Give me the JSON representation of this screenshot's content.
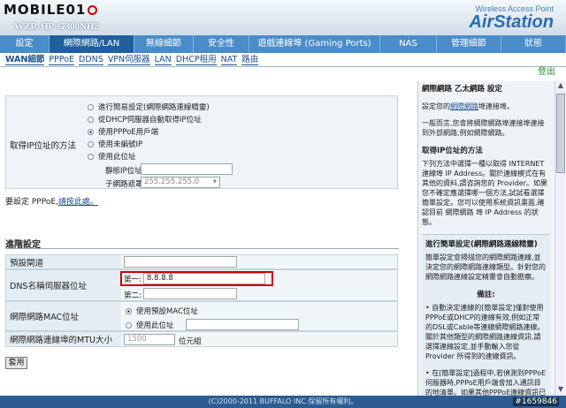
{
  "logo": "MOBILE01",
  "model": "WZR-HP-G300NH2",
  "brand": {
    "tagline": "Wireless Access Point",
    "name": "AirStation"
  },
  "nav": [
    {
      "label": "設定",
      "w": 56
    },
    {
      "label": "網際網路/LAN",
      "w": 96,
      "active": true
    },
    {
      "label": "無線細節",
      "w": 67
    },
    {
      "label": "安全性",
      "w": 63
    },
    {
      "label": "遊戲連線埠 (Gaming Ports)",
      "w": 148
    },
    {
      "label": "NAS",
      "w": 64
    },
    {
      "label": "管理細節",
      "w": 73
    },
    {
      "label": "狀態",
      "w": 73
    }
  ],
  "subnav": [
    "WAN細節",
    "PPPoE",
    "DDNS",
    "VPN伺服器",
    "LAN",
    "DHCP租用",
    "NAT",
    "路由"
  ],
  "logout": "登出",
  "ip": {
    "label": "取得IP位址的方法",
    "options": [
      "進行簡易設定(網際網路連線精靈)",
      "從DHCP伺服器自動取得IP位址",
      "使用PPPoE用戶端",
      "使用未編號IP",
      "使用此位址"
    ],
    "ip_label": "靜態IP位址",
    "mask_label": "子網路遮罩",
    "mask_value": "255.255.255.0"
  },
  "pppoe_note": "要設定 PPPoE,",
  "pppoe_link": "請按此處。",
  "advanced": {
    "title": "進階設定",
    "gateway": "預設閘道",
    "dns": "DNS名稱伺服器位址",
    "dns1_label": "第一:",
    "dns1_value": "8.8.8.8",
    "dns2_label": "第二:",
    "mac": "網際網路MAC位址",
    "mac_opt1": "使用預設MAC位址",
    "mac_opt2": "使用此位址",
    "mtu": "網際網路連線埠的MTU大小",
    "mtu_value": "1500",
    "mtu_unit": "位元組"
  },
  "apply": "套用",
  "footer": "(C)2000-2011 BUFFALO INC.保留所有權利。",
  "watermark": "#1659846",
  "help": {
    "title": "網際網路 乙太網路 設定",
    "p1a": "設定您的",
    "p1link": "網際網路",
    "p1b": "埠連接埠。",
    "p2": "一般而言,您會將網際網路埠連接埠連接到外部網路,例如網際網路。",
    "h2": "取得IP位址的方法",
    "p3": "下列方法中選擇一種以取得 INTERNET 連線埠 IP Address。關於連線模式在有其他的資料,請咨詢您的 Provider。如果您不確定應選擇哪一個方法,試試看選擇簡單設定。您可以使用系統資訊畫面,確認目前 網際網路 埠 IP Address 的狀態。",
    "h3": "進行簡單設定(網際網路連線精靈)",
    "p4": "簡單設定會掃描您的網際網路連線,並決定您的網際網路連線類型。針對您的網際網路連線設定精靈會自動勘察。",
    "h4": "備註:",
    "b1": "自動決定連線的[簡單設定]僅對使用PPPoE或DHCP的連線有效,例如正常的DSL或Cable等連線網際網路連線。關於其他類型的網際網路連線資訊,請選擇連線設定,並手動輸入您從 Provider 所得到的連線資訊。",
    "b2": "在[簡單設定]過程中,若偵測到PPPoE伺服器時,PPPoE用戶端會加入通訊目的地清單。如果其他PPPoE連線資訊已經登錄了,它會將您的新的PPPoE資訊覆蓋。"
  }
}
